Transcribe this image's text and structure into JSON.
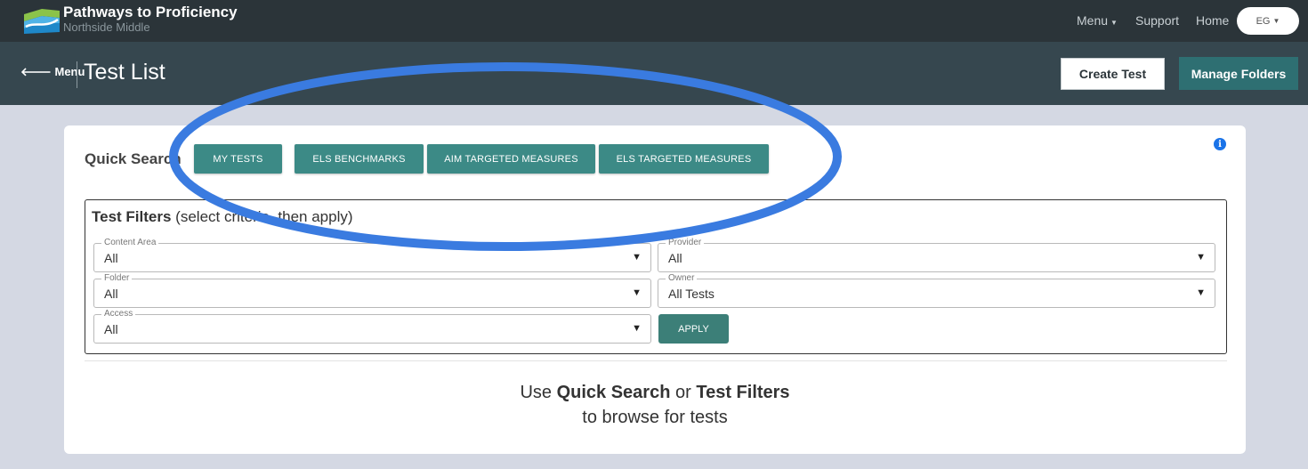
{
  "app": {
    "title": "Pathways to Proficiency",
    "school": "Northside Middle"
  },
  "topnav": {
    "menu": "Menu",
    "support": "Support",
    "home": "Home",
    "user_initials": "EG"
  },
  "header": {
    "back_label": "Menu",
    "page_title": "Test List",
    "create_test": "Create Test",
    "manage_folders": "Manage Folders"
  },
  "quick_search": {
    "label": "Quick Search",
    "buttons": [
      "MY TESTS",
      "ELS BENCHMARKS",
      "AIM TARGETED MEASURES",
      "ELS TARGETED MEASURES"
    ]
  },
  "filters": {
    "title": "Test Filters",
    "subtitle": "(select criteria, then apply)",
    "content_area": {
      "label": "Content Area",
      "value": "All"
    },
    "provider": {
      "label": "Provider",
      "value": "All"
    },
    "folder": {
      "label": "Folder",
      "value": "All"
    },
    "owner": {
      "label": "Owner",
      "value": "All Tests"
    },
    "access": {
      "label": "Access",
      "value": "All"
    },
    "apply": "APPLY"
  },
  "hint": {
    "use": "Use",
    "quick_search": "Quick Search",
    "or": "or",
    "test_filters": "Test Filters",
    "line2": "to browse for tests"
  },
  "colors": {
    "navbar": "#2b3439",
    "header": "#36474f",
    "accent": "#3c8a86",
    "annotation": "#3a7be0"
  }
}
